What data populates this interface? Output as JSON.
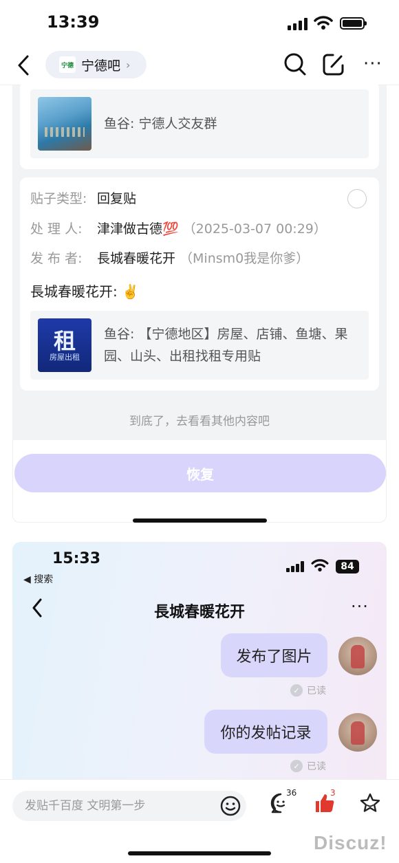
{
  "status_bar": {
    "time": "13:39"
  },
  "nav": {
    "forum_name": "宁德吧",
    "logo_text": "宁德",
    "icons": [
      "back-icon",
      "search-icon",
      "edit-icon",
      "more-icon"
    ]
  },
  "card1": {
    "share_text": "鱼谷: 宁德人交友群"
  },
  "card2": {
    "type_label": "贴子类型:",
    "type_value": "回复贴",
    "handler_label": "处 理 人:",
    "handler_value": "津津做古德💯",
    "handler_time": "（2025-03-07 00:29）",
    "poster_label": "发 布 者:",
    "poster_value": "長城春暖花开",
    "poster_alias": "（Minsm0我是你爹）",
    "content": "長城春暖花开: ✌️",
    "share_text": "鱼谷: 【宁德地区】房屋、店铺、鱼塘、果园、山头、出租找租专用贴",
    "thumb_big": "租",
    "thumb_small": "房屋出租"
  },
  "bottom_tip": "到底了，去看看其他内容吧",
  "restore_label": "恢复",
  "chat": {
    "time": "15:33",
    "back_to": "◀ 搜索",
    "battery": "84",
    "title": "長城春暖花开",
    "messages": [
      {
        "text": "发布了图片",
        "status": "已读"
      },
      {
        "text": "你的发帖记录",
        "status": "已读"
      }
    ]
  },
  "bottom_bar": {
    "input_placeholder": "发贴千百度 文明第一步",
    "comment_count": "36",
    "like_count": "3"
  },
  "watermark": "Discuz!",
  "colors": {
    "accent": "#d8d4fb",
    "bubble": "#d9d6fb",
    "like_red": "#e03a2f"
  }
}
